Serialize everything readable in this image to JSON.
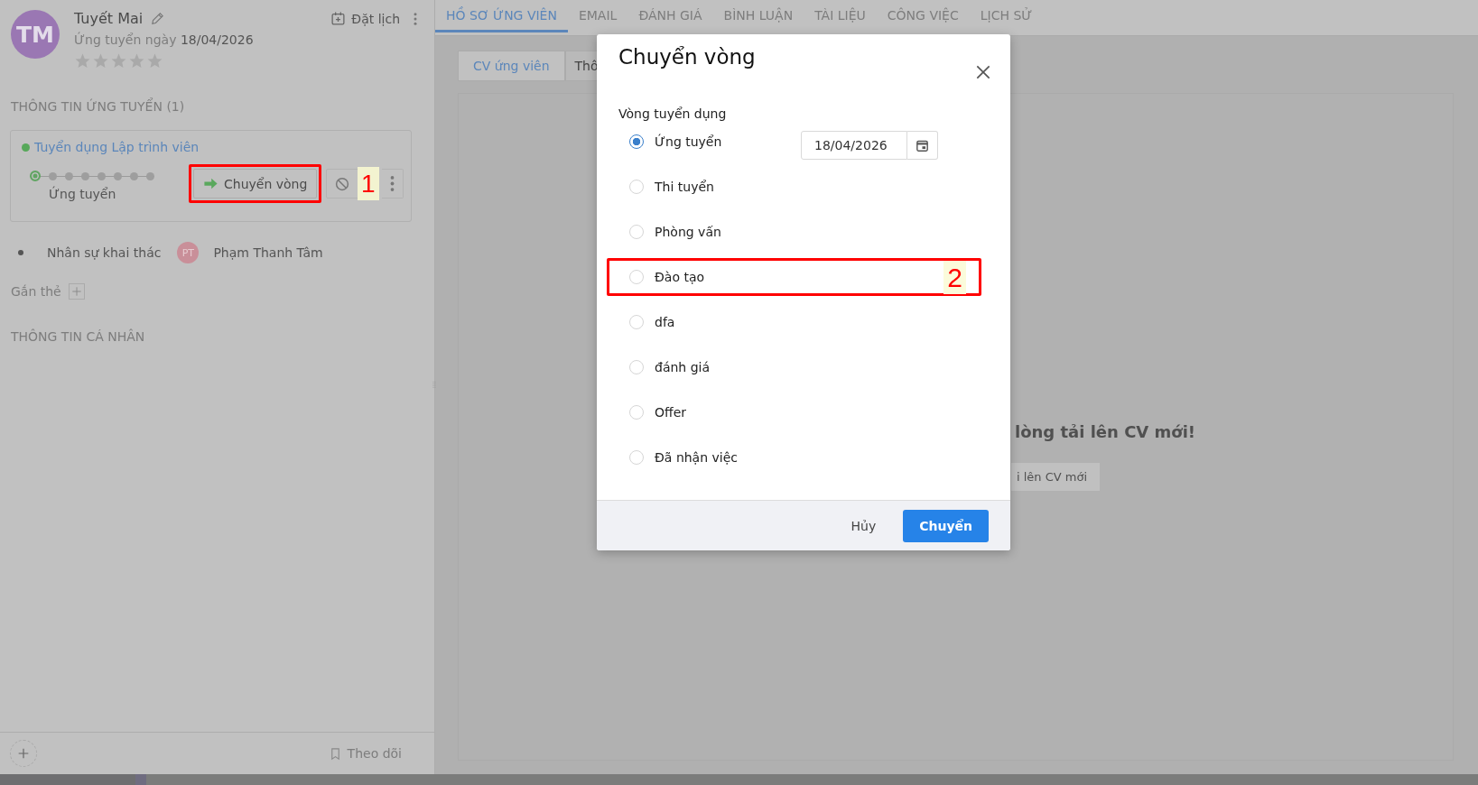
{
  "candidate": {
    "initials": "TM",
    "name": "Tuyết Mai",
    "applied_label": "Ứng tuyển ngày",
    "applied_date": "18/04/2026",
    "stars": 0,
    "schedule": "Đặt lịch"
  },
  "application_title": "THÔNG TIN ỨNG TUYỂN (1)",
  "job": {
    "title": "Tuyển dụng Lập trình viên",
    "color": "#57a85a",
    "stages": [
      {
        "selected": true
      },
      {
        "selected": false
      },
      {
        "selected": false
      },
      {
        "selected": false
      },
      {
        "selected": false
      },
      {
        "selected": false
      },
      {
        "selected": false
      },
      {
        "selected": false
      }
    ],
    "stage_label": "Ứng tuyển",
    "move_button": "Chuyển vòng",
    "move_highlighted": true,
    "callout": "1"
  },
  "recruiter": {
    "label": "Nhân sự khai thác",
    "initials": "PT",
    "name": "Phạm Thanh Tâm"
  },
  "tags_label": "Gắn thẻ",
  "personal_title": "THÔNG TIN CÁ NHÂN",
  "follow": "Theo dõi",
  "tabs": [
    {
      "label": "HỒ SƠ ỨNG VIÊN",
      "selected": true
    },
    {
      "label": "EMAIL",
      "selected": false
    },
    {
      "label": "ĐÁNH GIÁ",
      "selected": false
    },
    {
      "label": "BÌNH LUẬN",
      "selected": false
    },
    {
      "label": "TÀI LIỆU",
      "selected": false
    },
    {
      "label": "CÔNG VIỆC",
      "selected": false
    },
    {
      "label": "LỊCH SỬ",
      "selected": false
    }
  ],
  "subtabs": [
    {
      "label": "CV ứng viên",
      "selected": true
    },
    {
      "label": "Thô",
      "selected": false
    }
  ],
  "empty_message": "lòng tải lên CV mới!",
  "upload_button": "i lên CV mới",
  "dialog": {
    "title": "Chuyển vòng",
    "field_label": "Vòng tuyển dụng",
    "date": "18/04/2026",
    "callout": "2",
    "cancel": "Hủy",
    "confirm": "Chuyển",
    "rounds": [
      {
        "label": "Ứng tuyển",
        "selected": true,
        "highlighted": false
      },
      {
        "label": "Thi tuyển",
        "selected": false,
        "highlighted": false
      },
      {
        "label": "Phòng vấn",
        "selected": false,
        "highlighted": false
      },
      {
        "label": "Đào tạo",
        "selected": false,
        "highlighted": true
      },
      {
        "label": "dfa",
        "selected": false,
        "highlighted": false
      },
      {
        "label": "đánh giá",
        "selected": false,
        "highlighted": false
      },
      {
        "label": "Offer",
        "selected": false,
        "highlighted": false
      },
      {
        "label": "Đã nhận việc",
        "selected": false,
        "highlighted": false
      }
    ]
  }
}
